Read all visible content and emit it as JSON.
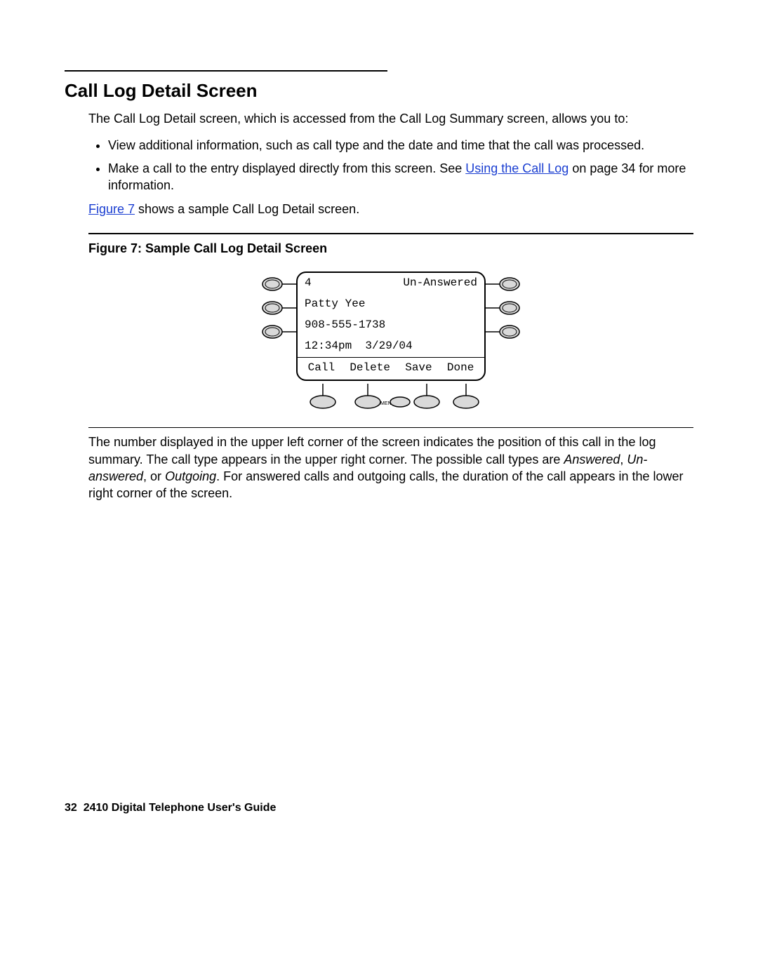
{
  "header": {
    "title": "Call Log Detail Screen"
  },
  "intro": {
    "lead": "The Call Log Detail screen, which is accessed from the Call Log Summary screen, allows you to:",
    "bullets": [
      "View additional information, such as call type and the date and time that the call was processed.",
      "Make a call to the entry displayed directly from this screen. See "
    ],
    "bullet2_link": "Using the Call Log",
    "bullet2_suffix": " on page 34 for more information.",
    "figref_link": "Figure 7",
    "figref_suffix": " shows a sample Call Log Detail screen."
  },
  "figure": {
    "caption": "Figure 7: Sample Call Log Detail Screen",
    "lcd": {
      "position": "4",
      "call_type": "Un-Answered",
      "name": "Patty Yee",
      "number": "908-555-1738",
      "time": "12:34pm",
      "date": "3/29/04",
      "softkeys": [
        "Call",
        "Delete",
        "Save",
        "Done"
      ],
      "menu_label": "MENU"
    }
  },
  "after_para": {
    "p1a": "The number displayed in the upper left corner of the screen indicates the position of this call in the log summary. The call type appears in the upper right corner. The possible call types are ",
    "t1": "Answered",
    "c1": ", ",
    "t2": "Un-answered",
    "c2": ", or ",
    "t3": "Outgoing",
    "p1b": ". For answered calls and outgoing calls, the duration of the call appears in the lower right corner of the screen."
  },
  "footer": {
    "page_number": "32",
    "doc_title": "2410 Digital Telephone User's Guide"
  }
}
